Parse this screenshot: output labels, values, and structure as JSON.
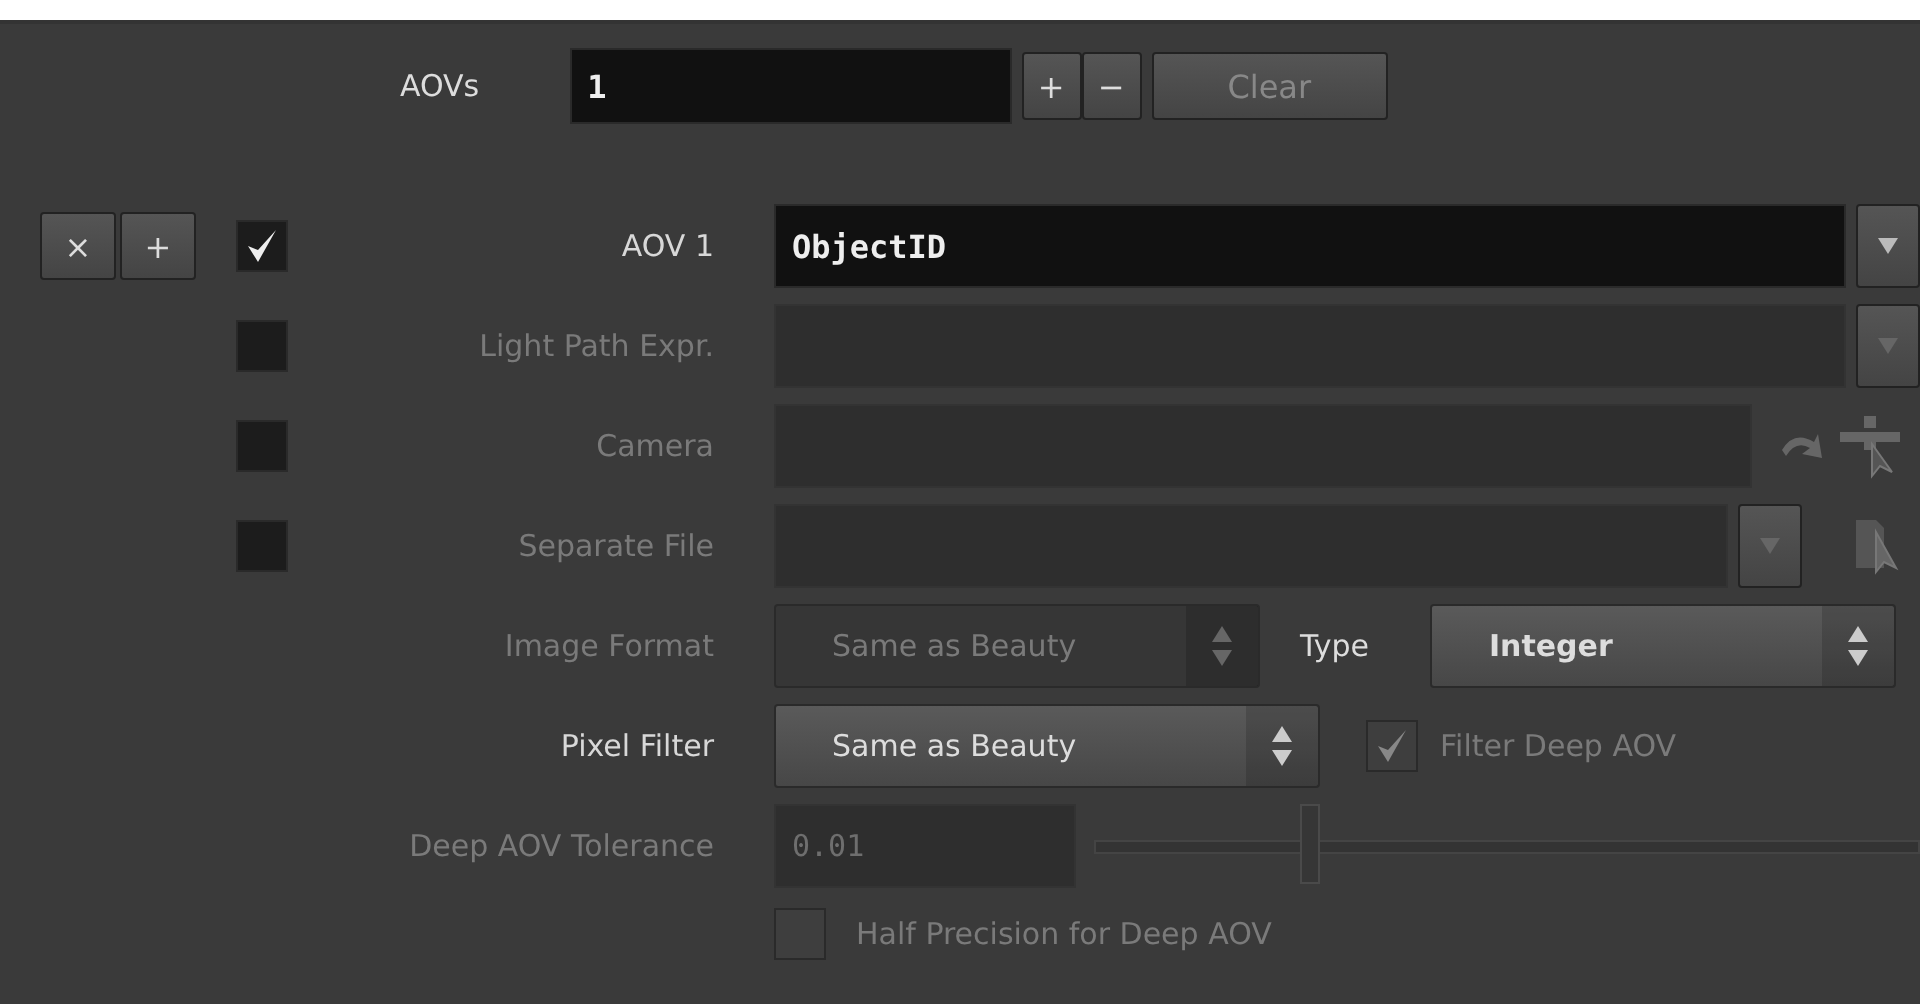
{
  "aovs": {
    "label": "AOVs",
    "value": "1",
    "add": "+",
    "remove": "−",
    "clear": "Clear"
  },
  "item_buttons": {
    "remove": "×",
    "add": "+"
  },
  "rows": [
    {
      "kind": "name",
      "label": "AOV 1",
      "checked": true,
      "disabled": false,
      "value": "ObjectID"
    },
    {
      "kind": "expr",
      "label": "Light Path Expr.",
      "checked": false,
      "disabled": true
    },
    {
      "kind": "node",
      "label": "Camera",
      "checked": false,
      "disabled": true
    },
    {
      "kind": "file",
      "label": "Separate File",
      "checked": false,
      "disabled": true
    },
    {
      "kind": "format",
      "label": "Image Format",
      "disabled": true,
      "value": "Same as Beauty",
      "type_label": "Type",
      "type_value": "Integer"
    },
    {
      "kind": "filter",
      "label": "Pixel Filter",
      "disabled": false,
      "value": "Same as Beauty",
      "option": {
        "label": "Filter Deep AOV",
        "checked": true,
        "disabled": true
      }
    },
    {
      "kind": "slider",
      "label": "Deep AOV Tolerance",
      "disabled": true,
      "value": "0.01",
      "level": 0.26
    },
    {
      "kind": "toggle",
      "label": "Half Precision for Deep AOV",
      "checked": false,
      "disabled": true
    }
  ]
}
